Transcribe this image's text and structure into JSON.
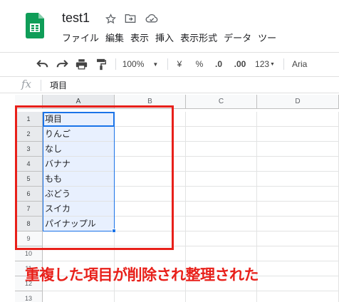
{
  "doc": {
    "title": "test1"
  },
  "menu": [
    "ファイル",
    "編集",
    "表示",
    "挿入",
    "表示形式",
    "データ",
    "ツー"
  ],
  "toolbar": {
    "zoom": "100%",
    "currency": "¥",
    "percent": "%",
    "decrease_decimals": ".0",
    "increase_decimals": ".00",
    "more_formats": "123",
    "font": "Aria"
  },
  "formula_bar": {
    "fx": "fx",
    "value": "項目"
  },
  "columns": [
    "A",
    "B",
    "C",
    "D"
  ],
  "rows": [
    {
      "num": "1",
      "a": "項目"
    },
    {
      "num": "2",
      "a": "りんご"
    },
    {
      "num": "3",
      "a": "なし"
    },
    {
      "num": "4",
      "a": "バナナ"
    },
    {
      "num": "5",
      "a": "もも"
    },
    {
      "num": "6",
      "a": "ぶどう"
    },
    {
      "num": "7",
      "a": "スイカ"
    },
    {
      "num": "8",
      "a": "パイナップル"
    },
    {
      "num": "9",
      "a": ""
    },
    {
      "num": "10",
      "a": ""
    },
    {
      "num": "11",
      "a": ""
    },
    {
      "num": "12",
      "a": ""
    },
    {
      "num": "13",
      "a": ""
    }
  ],
  "annotation": {
    "caption": "重複した項目が削除され整理された"
  },
  "colors": {
    "accent_red": "#e8201a",
    "selection_blue": "#1a73e8",
    "sheets_green": "#0f9d58"
  },
  "icons": [
    "sheets-logo-icon",
    "star-icon",
    "move-to-folder-icon",
    "cloud-status-icon",
    "undo-icon",
    "redo-icon",
    "print-icon",
    "paint-format-icon",
    "dropdown-arrow-icon"
  ]
}
